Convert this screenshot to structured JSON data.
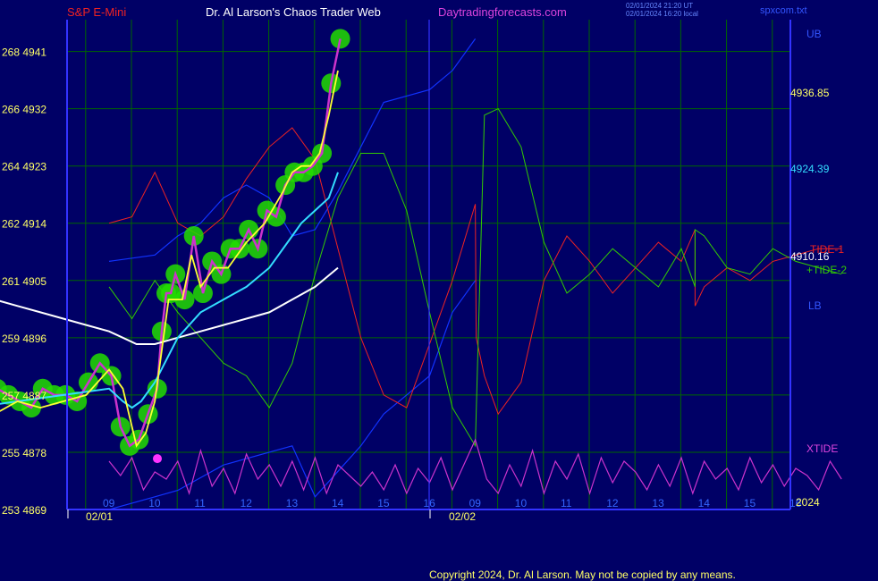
{
  "header": {
    "instrument": "S&P E-Mini",
    "site_title": "Dr. Al Larson's Chaos Trader Web",
    "website": "Daytradingforecasts.com",
    "timestamp_utc": "02/01/2024 21:20 UT",
    "timestamp_local": "02/01/2024 16:20 local",
    "filename": "spxcom.txt"
  },
  "footer": {
    "copyright": "Copyright 2024, Dr. Al Larson. May not be copied by any means."
  },
  "colors": {
    "background": "#000066",
    "grid": "#006600",
    "axis": "#3333ff",
    "price_bar": "#cc33cc",
    "glow": "#22dd00",
    "ma_fast": "#ffff33",
    "ma_mid": "#33ddff",
    "ma_slow": "#ffffff",
    "tide1": "#ee2222",
    "tide2": "#33cc00",
    "xtide": "#cc33cc",
    "band": "#1133ff"
  },
  "chart_data": {
    "type": "line",
    "title": "S&P E-Mini",
    "x_tick_labels": [
      "09",
      "10",
      "11",
      "12",
      "13",
      "14",
      "15",
      "16",
      "09",
      "10",
      "11",
      "12",
      "13",
      "14",
      "15",
      "16"
    ],
    "date_labels": [
      "02/01",
      "02/02"
    ],
    "year_label": "2024",
    "y_tick_labels": [
      "268 4941",
      "266 4932",
      "264 4923",
      "262 4914",
      "261 4905",
      "259 4896",
      "257 4887",
      "255 4878",
      "253 4869"
    ],
    "ylim": [
      4869,
      4946
    ],
    "right_labels": {
      "ub": "UB",
      "ub_value": "4936.85",
      "mid_value": "4924.39",
      "tide1": "TIDE-1",
      "tide1_value": "4910.16",
      "tide2": "+TIDE-2",
      "lb": "LB",
      "xtide": "XTIDE"
    },
    "series": [
      {
        "key": "price",
        "x": [
          0,
          0.25,
          0.5,
          0.75,
          1,
          1.25,
          1.5,
          1.75,
          2,
          2.25,
          2.5,
          2.75,
          3,
          3.2,
          3.4,
          3.6,
          3.8,
          4,
          4.1,
          4.2,
          4.3,
          4.4,
          4.6,
          4.8,
          5,
          5.2,
          5.4,
          5.6,
          5.8,
          6,
          6.2,
          6.4,
          6.6,
          6.8,
          7,
          7.2,
          7.4,
          7.6,
          7.8,
          8
        ],
        "values": [
          4885,
          4885,
          4888,
          4887,
          4886,
          4885,
          4888,
          4887,
          4887,
          4886,
          4889,
          4892,
          4890,
          4882,
          4879,
          4880,
          4884,
          4888,
          4897,
          4903,
          4903,
          4906,
          4902,
          4912,
          4903,
          4908,
          4906,
          4910,
          4910,
          4913,
          4910,
          4916,
          4915,
          4920,
          4922,
          4922,
          4923,
          4925,
          4936,
          4943
        ]
      },
      {
        "key": "ma_fast",
        "x": [
          0.2,
          0.5,
          1,
          1.5,
          2,
          2.5,
          3,
          3.3,
          3.6,
          3.8,
          4,
          4.3,
          4.6,
          4.8,
          5,
          5.3,
          5.6,
          6,
          6.4,
          6.8,
          7,
          7.2,
          7.4,
          7.6,
          7.8,
          8
        ],
        "values": [
          4876,
          4884,
          4886,
          4885,
          4886,
          4887,
          4891,
          4888,
          4879,
          4881,
          4886,
          4902,
          4902,
          4909,
          4904,
          4907,
          4907,
          4911,
          4914,
          4919,
          4922,
          4923,
          4923,
          4925,
          4931,
          4938
        ]
      },
      {
        "key": "ma_mid",
        "x": [
          0,
          1,
          2,
          3,
          3.3,
          3.5,
          3.7,
          4,
          4.5,
          5,
          5.5,
          6,
          6.5,
          7,
          7.2,
          7.5,
          7.8,
          8
        ],
        "values": [
          4885,
          4886,
          4887,
          4888,
          4886,
          4885,
          4886,
          4889,
          4896,
          4900,
          4902,
          4904,
          4907,
          4912,
          4914,
          4916,
          4918,
          4922
        ]
      },
      {
        "key": "ma_slow",
        "x": [
          0,
          0.5,
          1,
          1.5,
          2,
          2.5,
          3,
          3.3,
          3.6,
          4,
          4.5,
          5,
          5.5,
          6,
          6.5,
          7,
          7.5,
          8
        ],
        "values": [
          4904,
          4902,
          4901,
          4900,
          4899,
          4898,
          4897,
          4896,
          4895,
          4895,
          4896,
          4897,
          4898,
          4899,
          4900,
          4902,
          4904,
          4907
        ]
      },
      {
        "key": "ub",
        "x": [
          0,
          1,
          1.5,
          2,
          2.5,
          3,
          3.5,
          4,
          4.5,
          5,
          5.5,
          6,
          6.5,
          7,
          7.5,
          8
        ],
        "values": [
          4908,
          4909,
          4912,
          4914,
          4918,
          4920,
          4918,
          4912,
          4913,
          4919,
          4926,
          4933,
          4934,
          4935,
          4938,
          4943
        ]
      },
      {
        "key": "lb",
        "x": [
          0,
          0.5,
          1,
          1.5,
          2,
          2.5,
          3,
          3.5,
          4,
          4.5,
          5,
          5.5,
          6,
          6.5,
          7,
          7.5,
          8
        ],
        "values": [
          4869,
          4870,
          4871,
          4872,
          4874,
          4876,
          4877,
          4878,
          4879,
          4871,
          4875,
          4879,
          4884,
          4887,
          4890,
          4900,
          4905
        ]
      },
      {
        "key": "tide1",
        "x": [
          0,
          0.5,
          1,
          1.5,
          2,
          2.5,
          3,
          3.5,
          4,
          4.5,
          5,
          5.5,
          6,
          6.5,
          7,
          7.5,
          8,
          8.02,
          8.2,
          8.5,
          9,
          9.5,
          10,
          10.5,
          11,
          11.5,
          12,
          12.5,
          12.8,
          12.8,
          13,
          13.5,
          14,
          14.5,
          15,
          15.5,
          16
        ],
        "values": [
          4914,
          4915,
          4922,
          4914,
          4912,
          4915,
          4921,
          4926,
          4929,
          4924,
          4910,
          4896,
          4887,
          4885,
          4895,
          4905,
          4917,
          4896,
          4890,
          4884,
          4889,
          4905,
          4912,
          4908,
          4903,
          4907,
          4911,
          4908,
          4913,
          4901,
          4904,
          4907,
          4905,
          4908,
          4909,
          4910,
          4910
        ]
      },
      {
        "key": "tide2",
        "x": [
          0,
          0.5,
          1,
          1.5,
          2,
          2.5,
          3,
          3.5,
          4,
          4.5,
          5,
          5.5,
          6,
          6.5,
          7,
          7.5,
          8,
          8.2,
          8.5,
          9,
          9.5,
          10,
          10.5,
          11,
          11.5,
          12,
          12.5,
          12.8,
          12.8,
          13,
          13.5,
          14,
          14.5,
          15,
          15.5,
          16
        ],
        "values": [
          4904,
          4899,
          4905,
          4900,
          4896,
          4892,
          4890,
          4885,
          4892,
          4906,
          4918,
          4925,
          4925,
          4916,
          4900,
          4885,
          4879,
          4931,
          4932,
          4926,
          4911,
          4903,
          4906,
          4910,
          4907,
          4904,
          4910,
          4904,
          4913,
          4912,
          4907,
          4906,
          4910,
          4908,
          4907,
          4906
        ]
      },
      {
        "key": "xtide_level_fractions",
        "x": [
          0,
          0.25,
          0.5,
          0.75,
          1,
          1.25,
          1.5,
          1.75,
          2,
          2.25,
          2.5,
          2.75,
          3,
          3.25,
          3.5,
          3.75,
          4,
          4.25,
          4.5,
          4.75,
          5,
          5.25,
          5.5,
          5.75,
          6,
          6.25,
          6.5,
          6.75,
          7,
          7.25,
          7.5,
          7.75,
          8,
          8.25,
          8.5,
          8.75,
          9,
          9.25,
          9.5,
          9.75,
          10,
          10.25,
          10.5,
          10.75,
          11,
          11.25,
          11.5,
          11.75,
          12,
          12.25,
          12.5,
          12.75,
          13,
          13.25,
          13.5,
          13.75,
          14,
          14.25,
          14.5,
          14.75,
          15,
          15.25,
          15.5,
          15.75,
          16
        ],
        "values": [
          0.55,
          0.35,
          0.6,
          0.15,
          0.4,
          0.3,
          0.55,
          0.1,
          0.7,
          0.2,
          0.45,
          0.1,
          0.65,
          0.3,
          0.5,
          0.2,
          0.55,
          0.15,
          0.6,
          0.1,
          0.5,
          0.35,
          0.2,
          0.4,
          0.15,
          0.5,
          0.1,
          0.45,
          0.25,
          0.6,
          0.15,
          0.5,
          0.85,
          0.3,
          0.1,
          0.5,
          0.2,
          0.7,
          0.1,
          0.55,
          0.3,
          0.65,
          0.1,
          0.6,
          0.25,
          0.55,
          0.4,
          0.15,
          0.5,
          0.2,
          0.6,
          0.1,
          0.55,
          0.3,
          0.45,
          0.15,
          0.6,
          0.25,
          0.5,
          0.2,
          0.45,
          0.35,
          0.15,
          0.55,
          0.3
        ]
      }
    ]
  }
}
